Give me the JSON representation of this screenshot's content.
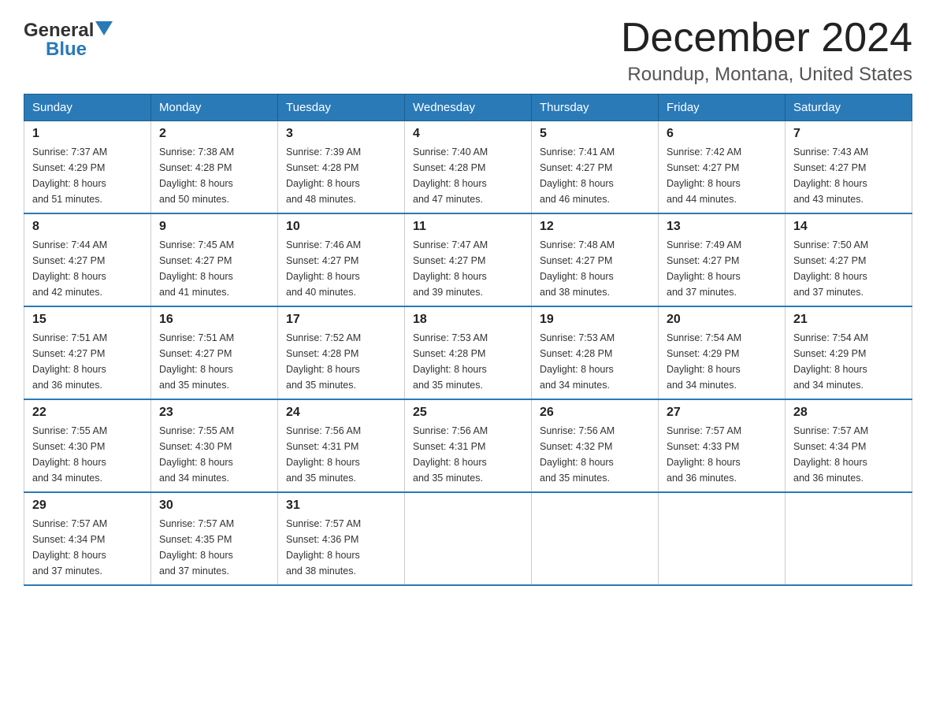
{
  "header": {
    "logo_general": "General",
    "logo_blue": "Blue",
    "title": "December 2024",
    "subtitle": "Roundup, Montana, United States"
  },
  "days_of_week": [
    "Sunday",
    "Monday",
    "Tuesday",
    "Wednesday",
    "Thursday",
    "Friday",
    "Saturday"
  ],
  "weeks": [
    [
      {
        "day": "1",
        "sunrise": "7:37 AM",
        "sunset": "4:29 PM",
        "daylight": "8 hours and 51 minutes."
      },
      {
        "day": "2",
        "sunrise": "7:38 AM",
        "sunset": "4:28 PM",
        "daylight": "8 hours and 50 minutes."
      },
      {
        "day": "3",
        "sunrise": "7:39 AM",
        "sunset": "4:28 PM",
        "daylight": "8 hours and 48 minutes."
      },
      {
        "day": "4",
        "sunrise": "7:40 AM",
        "sunset": "4:28 PM",
        "daylight": "8 hours and 47 minutes."
      },
      {
        "day": "5",
        "sunrise": "7:41 AM",
        "sunset": "4:27 PM",
        "daylight": "8 hours and 46 minutes."
      },
      {
        "day": "6",
        "sunrise": "7:42 AM",
        "sunset": "4:27 PM",
        "daylight": "8 hours and 44 minutes."
      },
      {
        "day": "7",
        "sunrise": "7:43 AM",
        "sunset": "4:27 PM",
        "daylight": "8 hours and 43 minutes."
      }
    ],
    [
      {
        "day": "8",
        "sunrise": "7:44 AM",
        "sunset": "4:27 PM",
        "daylight": "8 hours and 42 minutes."
      },
      {
        "day": "9",
        "sunrise": "7:45 AM",
        "sunset": "4:27 PM",
        "daylight": "8 hours and 41 minutes."
      },
      {
        "day": "10",
        "sunrise": "7:46 AM",
        "sunset": "4:27 PM",
        "daylight": "8 hours and 40 minutes."
      },
      {
        "day": "11",
        "sunrise": "7:47 AM",
        "sunset": "4:27 PM",
        "daylight": "8 hours and 39 minutes."
      },
      {
        "day": "12",
        "sunrise": "7:48 AM",
        "sunset": "4:27 PM",
        "daylight": "8 hours and 38 minutes."
      },
      {
        "day": "13",
        "sunrise": "7:49 AM",
        "sunset": "4:27 PM",
        "daylight": "8 hours and 37 minutes."
      },
      {
        "day": "14",
        "sunrise": "7:50 AM",
        "sunset": "4:27 PM",
        "daylight": "8 hours and 37 minutes."
      }
    ],
    [
      {
        "day": "15",
        "sunrise": "7:51 AM",
        "sunset": "4:27 PM",
        "daylight": "8 hours and 36 minutes."
      },
      {
        "day": "16",
        "sunrise": "7:51 AM",
        "sunset": "4:27 PM",
        "daylight": "8 hours and 35 minutes."
      },
      {
        "day": "17",
        "sunrise": "7:52 AM",
        "sunset": "4:28 PM",
        "daylight": "8 hours and 35 minutes."
      },
      {
        "day": "18",
        "sunrise": "7:53 AM",
        "sunset": "4:28 PM",
        "daylight": "8 hours and 35 minutes."
      },
      {
        "day": "19",
        "sunrise": "7:53 AM",
        "sunset": "4:28 PM",
        "daylight": "8 hours and 34 minutes."
      },
      {
        "day": "20",
        "sunrise": "7:54 AM",
        "sunset": "4:29 PM",
        "daylight": "8 hours and 34 minutes."
      },
      {
        "day": "21",
        "sunrise": "7:54 AM",
        "sunset": "4:29 PM",
        "daylight": "8 hours and 34 minutes."
      }
    ],
    [
      {
        "day": "22",
        "sunrise": "7:55 AM",
        "sunset": "4:30 PM",
        "daylight": "8 hours and 34 minutes."
      },
      {
        "day": "23",
        "sunrise": "7:55 AM",
        "sunset": "4:30 PM",
        "daylight": "8 hours and 34 minutes."
      },
      {
        "day": "24",
        "sunrise": "7:56 AM",
        "sunset": "4:31 PM",
        "daylight": "8 hours and 35 minutes."
      },
      {
        "day": "25",
        "sunrise": "7:56 AM",
        "sunset": "4:31 PM",
        "daylight": "8 hours and 35 minutes."
      },
      {
        "day": "26",
        "sunrise": "7:56 AM",
        "sunset": "4:32 PM",
        "daylight": "8 hours and 35 minutes."
      },
      {
        "day": "27",
        "sunrise": "7:57 AM",
        "sunset": "4:33 PM",
        "daylight": "8 hours and 36 minutes."
      },
      {
        "day": "28",
        "sunrise": "7:57 AM",
        "sunset": "4:34 PM",
        "daylight": "8 hours and 36 minutes."
      }
    ],
    [
      {
        "day": "29",
        "sunrise": "7:57 AM",
        "sunset": "4:34 PM",
        "daylight": "8 hours and 37 minutes."
      },
      {
        "day": "30",
        "sunrise": "7:57 AM",
        "sunset": "4:35 PM",
        "daylight": "8 hours and 37 minutes."
      },
      {
        "day": "31",
        "sunrise": "7:57 AM",
        "sunset": "4:36 PM",
        "daylight": "8 hours and 38 minutes."
      },
      null,
      null,
      null,
      null
    ]
  ],
  "labels": {
    "sunrise": "Sunrise:",
    "sunset": "Sunset:",
    "daylight": "Daylight:"
  }
}
